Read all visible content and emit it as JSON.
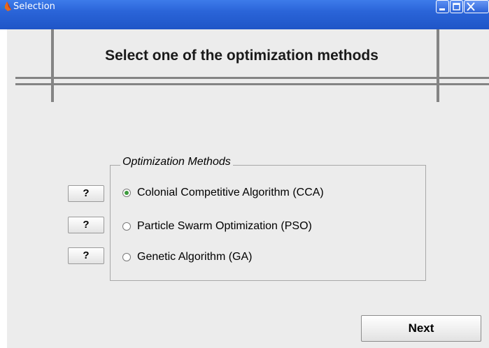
{
  "window": {
    "title": "Selection",
    "app_icon": "matlab-icon",
    "controls": [
      "minimize-icon",
      "maximize-icon",
      "close-icon"
    ]
  },
  "header": {
    "title": "Select one of the optimization methods"
  },
  "methods_group": {
    "title": "Optimization Methods",
    "options": [
      {
        "label": "Colonial Competitive Algorithm (CCA)",
        "selected": true
      },
      {
        "label": "Particle Swarm Optimization (PSO)",
        "selected": false
      },
      {
        "label": "Genetic Algorithm (GA)",
        "selected": false
      }
    ]
  },
  "help_buttons": [
    {
      "label": "?"
    },
    {
      "label": "?"
    },
    {
      "label": "?"
    }
  ],
  "footer": {
    "next_label": "Next"
  },
  "colors": {
    "title_bar": "#2a64d8",
    "client_background": "#ececec",
    "radio_selected": "#3c9a3c",
    "divider": "#848484"
  }
}
